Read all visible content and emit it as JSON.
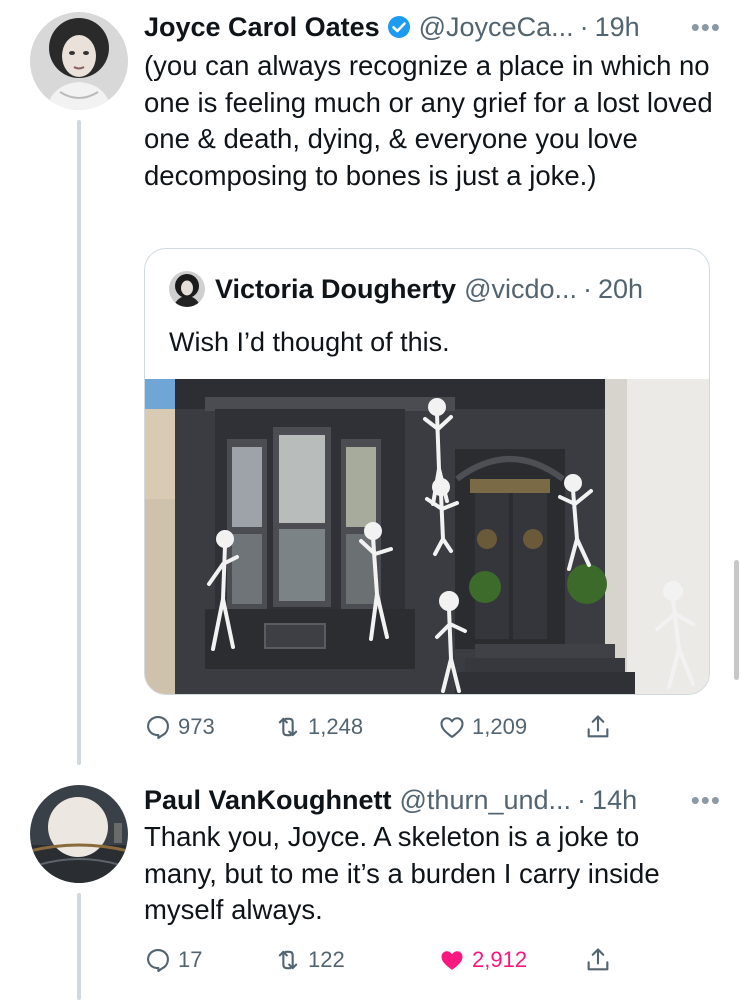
{
  "tweet1": {
    "name": "Joyce Carol Oates",
    "handle": "@JoyceCa...",
    "dot": "·",
    "time": "19h",
    "text": "(you can always recognize a place in which no one is feeling much or any grief for a lost loved one & death, dying, & everyone you love decomposing to bones is just a joke.)",
    "quote": {
      "name": "Victoria Dougherty",
      "handle": "@vicdo...",
      "dot": "·",
      "time": "20h",
      "text": "Wish I’d thought of this."
    },
    "actions": {
      "replies": "973",
      "retweets": "1,248",
      "likes": "1,209"
    }
  },
  "tweet2": {
    "name": "Paul VanKoughnett",
    "handle": "@thurn_und...",
    "dot": "·",
    "time": "14h",
    "text": "Thank you, Joyce. A skeleton is a joke to many, but to me it’s a burden I carry inside myself always.",
    "actions": {
      "replies": "17",
      "retweets": "122",
      "likes": "2,912"
    }
  },
  "more_label": "•••",
  "icons": [
    "verified-badge-icon",
    "reply-icon",
    "retweet-icon",
    "like-icon",
    "like-filled-icon",
    "share-icon",
    "more-icon"
  ],
  "colors": {
    "text": "#0f1419",
    "secondary": "#536471",
    "verified": "#1d9bf0",
    "like": "#f91880",
    "border": "#cfd9de"
  }
}
